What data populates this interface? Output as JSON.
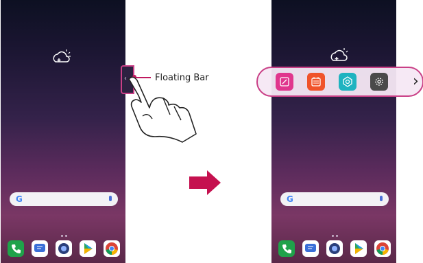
{
  "callout": {
    "floating_bar_label": "Floating Bar"
  },
  "left_screen": {
    "search": {
      "logo": "G"
    },
    "dock_icons": [
      "phone-icon",
      "messages-icon",
      "camera-icon",
      "play-store-icon",
      "chrome-icon"
    ]
  },
  "right_screen": {
    "search": {
      "logo": "G"
    },
    "floating_bar_icons": [
      "memo-icon",
      "calendar-icon",
      "capture-icon",
      "settings-icon"
    ],
    "expand_icon": "chevron-right-icon"
  },
  "colors": {
    "accent": "#c93f86",
    "callout_line": "#c0195f",
    "arrow": "#c5114f",
    "memo_tile": "#e0368d",
    "calendar_tile": "#f0532a",
    "capture_tile": "#1fb3c0",
    "settings_tile": "#4a4a4a"
  }
}
